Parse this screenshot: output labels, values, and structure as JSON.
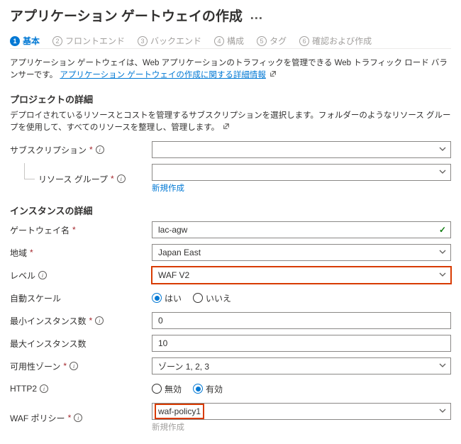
{
  "title": "アプリケーション ゲートウェイの作成",
  "tabs": [
    {
      "num": "1",
      "label": "基本"
    },
    {
      "num": "2",
      "label": "フロントエンド"
    },
    {
      "num": "3",
      "label": "バックエンド"
    },
    {
      "num": "4",
      "label": "構成"
    },
    {
      "num": "5",
      "label": "タグ"
    },
    {
      "num": "6",
      "label": "確認および作成"
    }
  ],
  "intro": {
    "text": "アプリケーション ゲートウェイは、Web アプリケーションのトラフィックを管理できる Web トラフィック ロード バランサーです。",
    "link": "アプリケーション ゲートウェイの作成に関する詳細情報"
  },
  "project": {
    "heading": "プロジェクトの詳細",
    "desc": "デプロイされているリソースとコストを管理するサブスクリプションを選択します。フォルダーのようなリソース グループを使用して、すべてのリソースを整理し、管理します。",
    "subscription_label": "サブスクリプション",
    "subscription_value": "",
    "resource_group_label": "リソース グループ",
    "resource_group_value": "",
    "new_link": "新規作成"
  },
  "instance": {
    "heading": "インスタンスの詳細",
    "gateway_name_label": "ゲートウェイ名",
    "gateway_name_value": "lac-agw",
    "region_label": "地域",
    "region_value": "Japan East",
    "level_label": "レベル",
    "level_value": "WAF V2",
    "autoscale_label": "自動スケール",
    "autoscale_yes": "はい",
    "autoscale_no": "いいえ",
    "min_label": "最小インスタンス数",
    "min_value": "0",
    "max_label": "最大インスタンス数",
    "max_value": "10",
    "zones_label": "可用性ゾーン",
    "zones_value": "ゾーン 1, 2, 3",
    "http2_label": "HTTP2",
    "http2_disabled": "無効",
    "http2_enabled": "有効",
    "waf_label": "WAF ポリシー",
    "waf_value": "waf-policy1",
    "waf_new_link": "新規作成"
  }
}
